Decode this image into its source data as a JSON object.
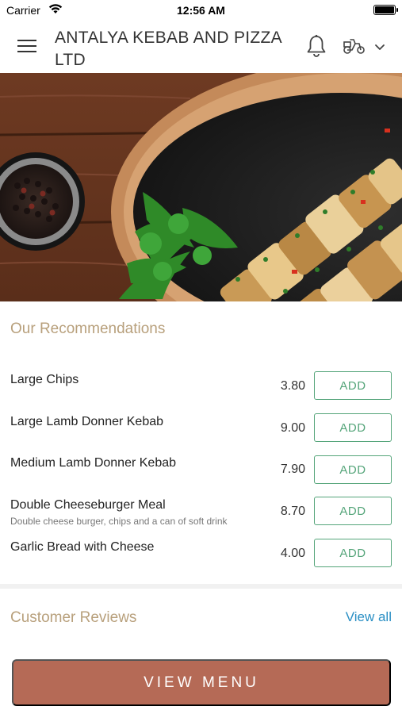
{
  "status_bar": {
    "carrier": "Carrier",
    "time": "12:56 AM"
  },
  "header": {
    "store_name": "ANTALYA KEBAB AND PIZZA LTD",
    "icons": [
      "menu-icon",
      "bell-icon",
      "delivery-scooter-icon",
      "chevron-down-icon"
    ]
  },
  "hero": {
    "image": "kebab skewers on a plate with parsley and peppercorns"
  },
  "recommendations": {
    "title": "Our Recommendations",
    "items": [
      {
        "name": "Large Chips",
        "description": "",
        "price": "3.80",
        "action": "ADD"
      },
      {
        "name": "Large Lamb Donner Kebab",
        "description": "",
        "price": "9.00",
        "action": "ADD"
      },
      {
        "name": "Medium Lamb Donner Kebab",
        "description": "",
        "price": "7.90",
        "action": "ADD"
      },
      {
        "name": "Double Cheeseburger Meal",
        "description": "Double cheese burger, chips and a can of soft drink",
        "price": "8.70",
        "action": "ADD"
      },
      {
        "name": "Garlic Bread with Cheese",
        "description": "",
        "price": "4.00",
        "action": "ADD"
      }
    ]
  },
  "reviews": {
    "title": "Customer Reviews",
    "view_all": "View all"
  },
  "footer": {
    "view_menu": "VIEW MENU"
  },
  "colors": {
    "section_title": "#b8a07c",
    "add_button": "#55a57a",
    "link": "#2a8fc4",
    "primary_button": "#b56a56"
  }
}
